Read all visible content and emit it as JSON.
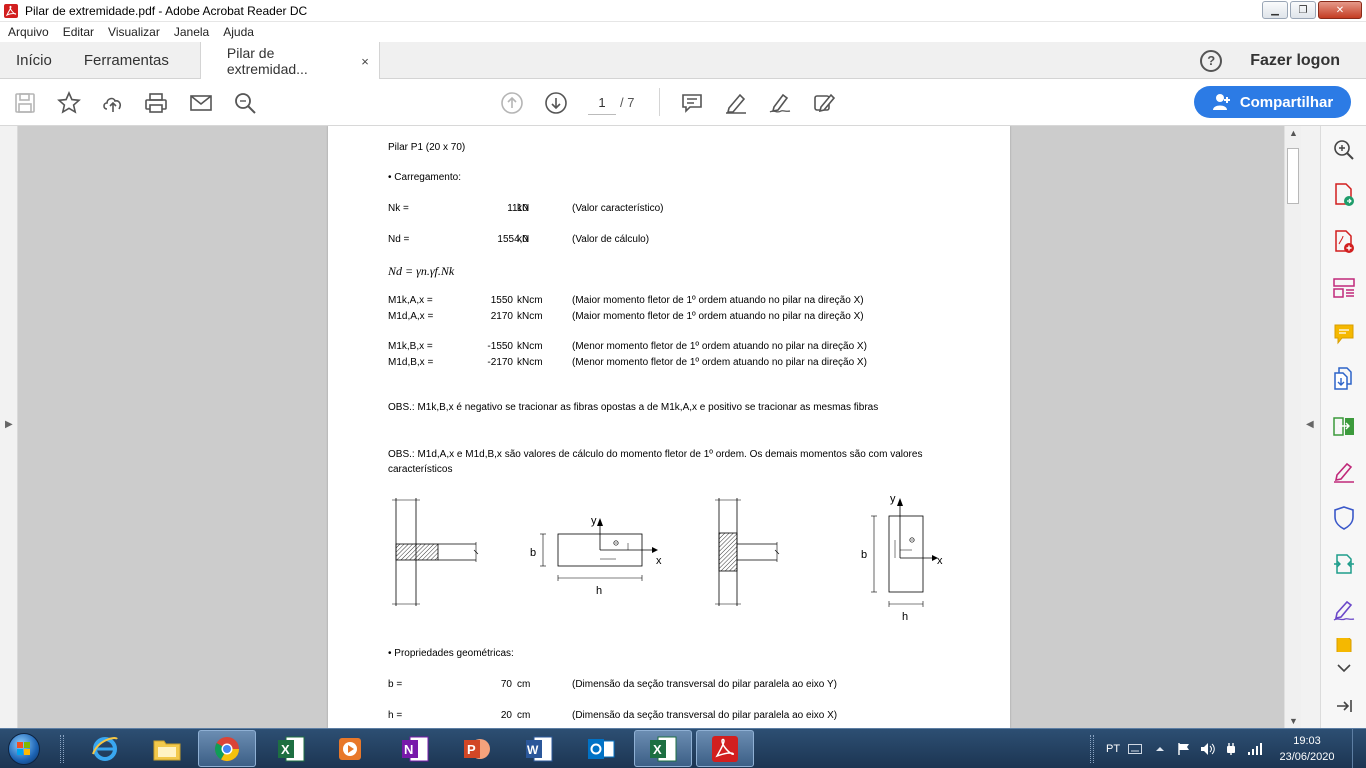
{
  "window": {
    "title": "Pilar de extremidade.pdf - Adobe Acrobat Reader DC"
  },
  "menu": [
    "Arquivo",
    "Editar",
    "Visualizar",
    "Janela",
    "Ajuda"
  ],
  "tabs": {
    "home": "Início",
    "tools": "Ferramentas",
    "document": "Pilar de extremidad...",
    "close_glyph": "×"
  },
  "header_right": {
    "help": "?",
    "login": "Fazer logon"
  },
  "toolbar": {
    "current_page": "1",
    "total_pages": "/ 7",
    "share_label": "Compartilhar"
  },
  "pdf": {
    "title": "Pilar P1 (20 x 70)",
    "section_loading": "• Carregamento:",
    "nk": {
      "label": "Nk =",
      "value": "1110",
      "unit": "kN",
      "desc": "(Valor característico)"
    },
    "nd": {
      "label": "Nd =",
      "value": "1554,0",
      "unit": "kN",
      "desc": "(Valor de cálculo)"
    },
    "formula": "Nd = γn.γf.Nk",
    "m1kax": {
      "label": "M1k,A,x =",
      "value": "1550",
      "unit": "kNcm",
      "desc": "(Maior momento fletor de 1º ordem atuando no pilar na direção X)"
    },
    "m1dax": {
      "label": "M1d,A,x =",
      "value": "2170",
      "unit": "kNcm",
      "desc": "(Maior momento fletor de 1º ordem atuando no pilar na direção X)"
    },
    "m1kbx": {
      "label": "M1k,B,x =",
      "value": "-1550",
      "unit": "kNcm",
      "desc": "(Menor momento fletor de 1º ordem atuando no pilar na direção X)"
    },
    "m1dbx": {
      "label": "M1d,B,x =",
      "value": "-2170",
      "unit": "kNcm",
      "desc": "(Menor momento fletor de 1º ordem atuando no pilar na direção X)"
    },
    "obs1": "OBS.:  M1k,B,x é negativo se tracionar as fibras opostas a de M1k,A,x e positivo se tracionar as mesmas fibras",
    "obs2": "OBS.: M1d,A,x e M1d,B,x são valores de cálculo do momento fletor de 1º ordem. Os demais momentos são com valores característicos",
    "fig": {
      "y": "y",
      "x": "x",
      "b": "b",
      "h": "h"
    },
    "section_geometry": "• Propriedades geométricas:",
    "b": {
      "label": "b =",
      "value": "70",
      "unit": "cm",
      "desc": "(Dimensão da seção transversal do pilar paralela ao eixo Y)"
    },
    "h": {
      "label": "h =",
      "value": "20",
      "unit": "cm",
      "desc": "(Dimensão da seção transversal do pilar paralela ao eixo X)"
    }
  },
  "taskbar": {
    "language": "PT",
    "time": "19:03",
    "date": "23/06/2020"
  },
  "colors": {
    "acrobat_red": "#d21f1f",
    "share_blue": "#2c7be5",
    "taskbar": "#1c3552"
  }
}
